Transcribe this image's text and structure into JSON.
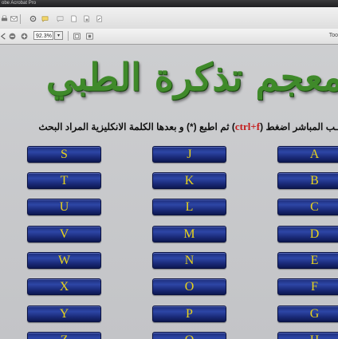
{
  "window": {
    "title": "obe Acrobat Pro"
  },
  "toolbar": {
    "zoom_value": "92.3%",
    "tools_label": "Too"
  },
  "document": {
    "title": "معجم تذكرة الطبي",
    "instruction": {
      "before": "ـب المباشر اضغط (",
      "key": "ctrl+f",
      "after": ") ثم اطبع (*) و بعدها الكلمة الانكليزية المراد البحث"
    },
    "letters_col1": [
      "S",
      "T",
      "U",
      "V",
      "W",
      "X",
      "Y",
      "Z"
    ],
    "letters_col2": [
      "J",
      "K",
      "L",
      "M",
      "N",
      "O",
      "P",
      "Q"
    ],
    "letters_col3": [
      "A",
      "B",
      "C",
      "D",
      "E",
      "F",
      "G",
      "H"
    ]
  }
}
